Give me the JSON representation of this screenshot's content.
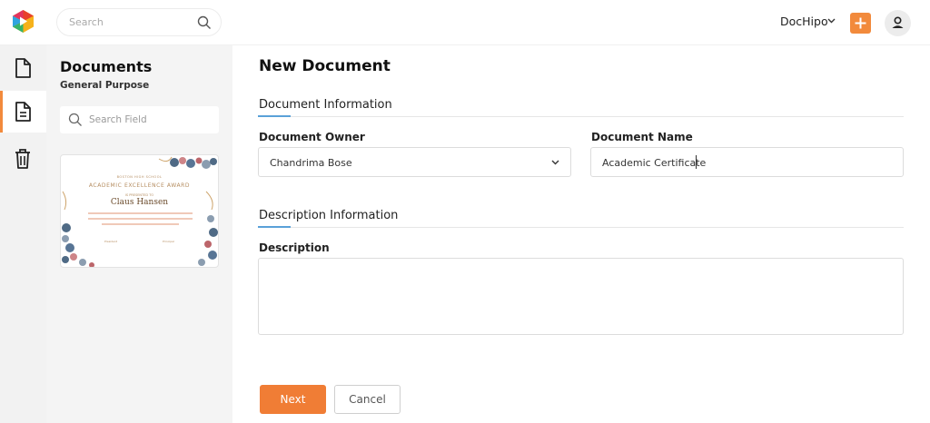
{
  "header": {
    "search_placeholder": "Search",
    "brand_name": "DocHipo"
  },
  "rail": {
    "items": [
      {
        "name": "documents",
        "icon": "document-icon",
        "active": false
      },
      {
        "name": "text-documents",
        "icon": "text-document-icon",
        "active": true
      },
      {
        "name": "trash",
        "icon": "trash-icon",
        "active": false
      }
    ]
  },
  "panel": {
    "title": "Documents",
    "subtitle": "General Purpose",
    "search_placeholder": "Search Field",
    "template": {
      "school": "BOSTON HIGH SCHOOL",
      "award": "ACADEMIC EXCELLENCE AWARD",
      "presented": "IS PRESENTED TO",
      "recipient": "Claus Hansen",
      "signer_left": "President",
      "signer_right": "Principal"
    }
  },
  "form": {
    "title": "New Document",
    "document_information": {
      "heading": "Document Information",
      "owner_label": "Document Owner",
      "owner_value": "Chandrima Bose",
      "name_label": "Document Name",
      "name_value": "Academic Certificate"
    },
    "description_information": {
      "heading": "Description Information",
      "description_label": "Description",
      "description_value": ""
    },
    "next_label": "Next",
    "cancel_label": "Cancel"
  },
  "colors": {
    "accent": "#f07d35",
    "section_accent": "#5aa1d8"
  }
}
